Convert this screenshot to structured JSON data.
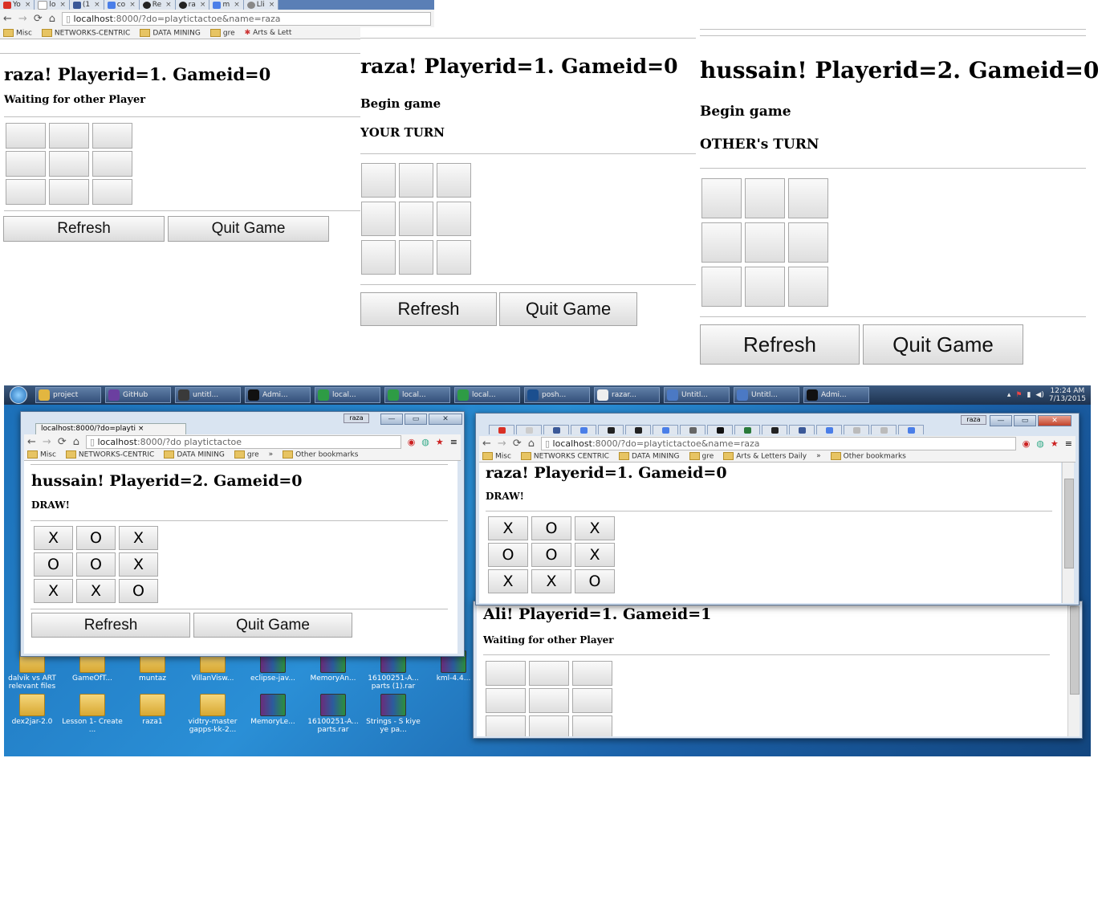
{
  "browser": {
    "tabs": [
      "Yo",
      "lo",
      "(1",
      "co",
      "Re",
      "ra",
      "m",
      "Lli"
    ],
    "url_host": "localhost",
    "url_rest": ":8000/?do=playtictactoe&name=raza",
    "bookmarks": [
      "Misc",
      "NETWORKS-CENTRIC",
      "DATA MINING",
      "gre",
      "Arts & Lett"
    ]
  },
  "panel1": {
    "title": "raza! Playerid=1. Gameid=0",
    "message": "Waiting for other Player",
    "cells": [
      "",
      "",
      "",
      "",
      "",
      "",
      "",
      "",
      ""
    ]
  },
  "panel2": {
    "title": "raza! Playerid=1. Gameid=0",
    "message1": "Begin game",
    "message2": "YOUR TURN",
    "cells": [
      "",
      "",
      "",
      "",
      "",
      "",
      "",
      "",
      ""
    ]
  },
  "panel3": {
    "title": "hussain! Playerid=2. Gameid=0",
    "message1": "Begin game",
    "message2": "OTHER's TURN",
    "cells": [
      "",
      "",
      "",
      "",
      "",
      "",
      "",
      "",
      ""
    ]
  },
  "buttons": {
    "refresh": "Refresh",
    "quit": "Quit Game"
  },
  "taskbar": {
    "items": [
      "project",
      "GitHub",
      "untitl...",
      "Admi...",
      "local...",
      "local...",
      "local...",
      "posh...",
      "razar...",
      "Untitl...",
      "Untitl...",
      "Admi..."
    ],
    "time": "12:24 AM",
    "date": "7/13/2015"
  },
  "desktop_icons": {
    "row1": [
      "dalvik vs ART relevant files",
      "GameOfT...",
      "muntaz",
      "VillanVisw...",
      "eclipse-jav...",
      "MemoryAn...",
      "16100251-A... parts (1).rar",
      "kml-4.4..."
    ],
    "row2": [
      "dex2jar-2.0",
      "Lesson 1- Create ...",
      "raza1",
      "vidtry-master gapps-kk-2...",
      "MemoryLe...",
      "16100251-A... parts.rar",
      "Strings - S kiye ye pa..."
    ]
  },
  "win_left": {
    "tab": "localhost:8000/?do=playti",
    "url_host": "localhost",
    "url_rest": ":8000/?do   playtictactoe",
    "user_badge": "raza",
    "bookmarks": [
      "Misc",
      "NETWORKS-CENTRIC",
      "DATA MINING",
      "gre",
      "»",
      "Other bookmarks"
    ],
    "title": "hussain! Playerid=2. Gameid=0",
    "message": "DRAW!",
    "cells": [
      "X",
      "O",
      "X",
      "O",
      "O",
      "X",
      "X",
      "X",
      "O"
    ]
  },
  "win_right": {
    "url_host": "localhost",
    "url_rest": ":8000/?do=playtictactoe&name=raza",
    "user_badge": "raza",
    "bookmarks": [
      "Misc",
      "NETWORKS CENTRIC",
      "DATA MINING",
      "gre",
      "Arts & Letters Daily",
      "»",
      "Other bookmarks"
    ],
    "title": "raza! Playerid=1. Gameid=0",
    "message": "DRAW!",
    "cells": [
      "X",
      "O",
      "X",
      "O",
      "O",
      "X",
      "X",
      "X",
      "O"
    ]
  },
  "win_back": {
    "title": "Ali! Playerid=1. Gameid=1",
    "message": "Waiting for other Player",
    "cells": [
      "",
      "",
      "",
      "",
      "",
      "",
      "",
      "",
      ""
    ]
  }
}
